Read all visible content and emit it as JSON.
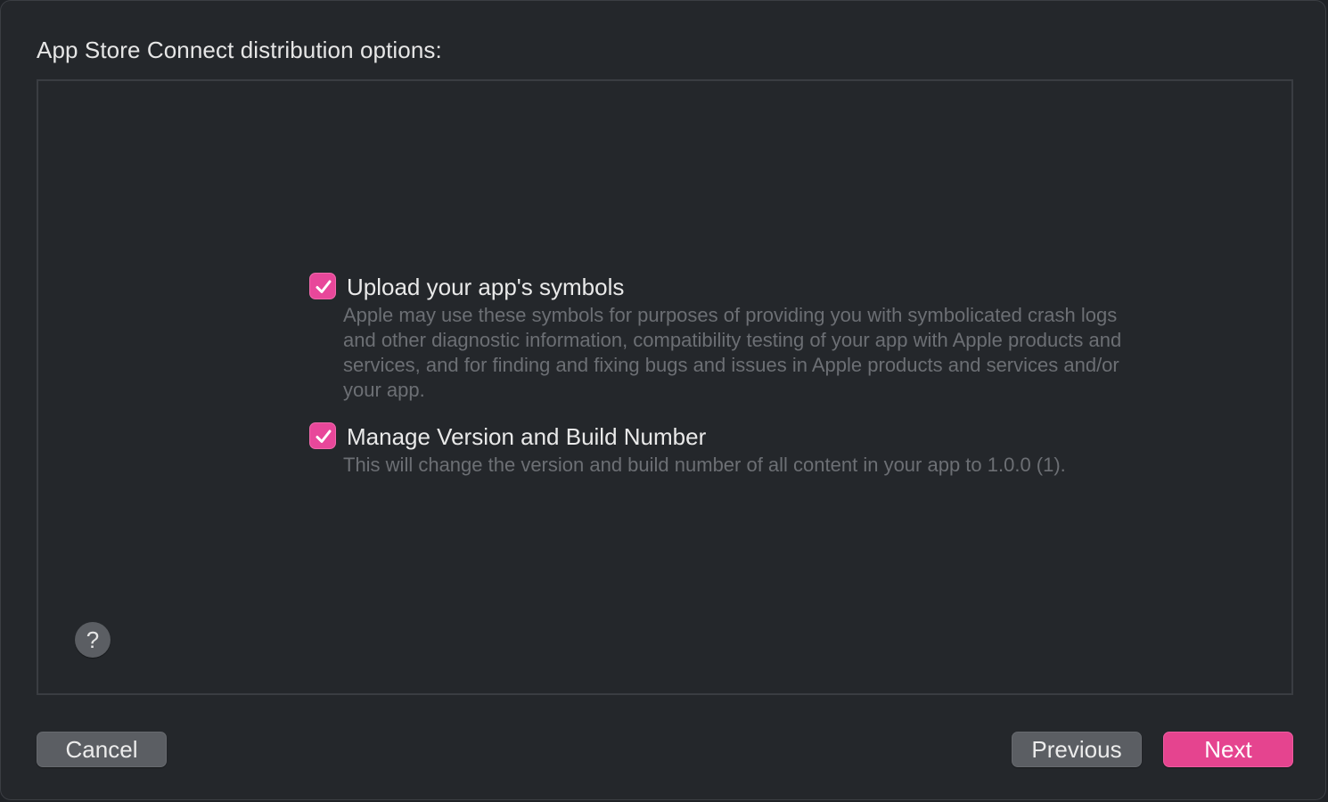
{
  "dialog": {
    "title": "App Store Connect distribution options:"
  },
  "options": [
    {
      "label": "Upload your app's symbols",
      "checked": true,
      "description": "Apple may use these symbols for purposes of providing you with symbolicated crash logs and other diagnostic information, compatibility testing of your app with Apple products and services, and for finding and fixing bugs and issues in Apple products and services and/or your app."
    },
    {
      "label": "Manage Version and Build Number",
      "checked": true,
      "description": "This will change the version and build number of all content in your app to 1.0.0 (1)."
    }
  ],
  "help": {
    "label": "?"
  },
  "buttons": {
    "cancel": "Cancel",
    "previous": "Previous",
    "next": "Next"
  },
  "colors": {
    "accent": "#e8479a",
    "background": "#24272b",
    "button": "#5b5e63",
    "description_text": "#6c6f74"
  },
  "icons": {
    "checkbox": "checkmark-icon",
    "help": "question-mark-icon"
  }
}
